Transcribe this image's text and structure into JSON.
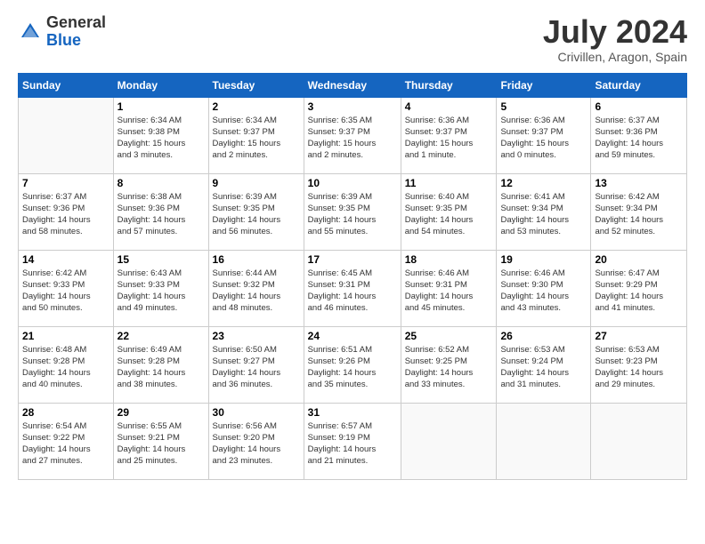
{
  "header": {
    "logo_general": "General",
    "logo_blue": "Blue",
    "month_year": "July 2024",
    "location": "Crivillen, Aragon, Spain"
  },
  "weekdays": [
    "Sunday",
    "Monday",
    "Tuesday",
    "Wednesday",
    "Thursday",
    "Friday",
    "Saturday"
  ],
  "weeks": [
    [
      {
        "day": "",
        "info": ""
      },
      {
        "day": "1",
        "info": "Sunrise: 6:34 AM\nSunset: 9:38 PM\nDaylight: 15 hours\nand 3 minutes."
      },
      {
        "day": "2",
        "info": "Sunrise: 6:34 AM\nSunset: 9:37 PM\nDaylight: 15 hours\nand 2 minutes."
      },
      {
        "day": "3",
        "info": "Sunrise: 6:35 AM\nSunset: 9:37 PM\nDaylight: 15 hours\nand 2 minutes."
      },
      {
        "day": "4",
        "info": "Sunrise: 6:36 AM\nSunset: 9:37 PM\nDaylight: 15 hours\nand 1 minute."
      },
      {
        "day": "5",
        "info": "Sunrise: 6:36 AM\nSunset: 9:37 PM\nDaylight: 15 hours\nand 0 minutes."
      },
      {
        "day": "6",
        "info": "Sunrise: 6:37 AM\nSunset: 9:36 PM\nDaylight: 14 hours\nand 59 minutes."
      }
    ],
    [
      {
        "day": "7",
        "info": "Sunrise: 6:37 AM\nSunset: 9:36 PM\nDaylight: 14 hours\nand 58 minutes."
      },
      {
        "day": "8",
        "info": "Sunrise: 6:38 AM\nSunset: 9:36 PM\nDaylight: 14 hours\nand 57 minutes."
      },
      {
        "day": "9",
        "info": "Sunrise: 6:39 AM\nSunset: 9:35 PM\nDaylight: 14 hours\nand 56 minutes."
      },
      {
        "day": "10",
        "info": "Sunrise: 6:39 AM\nSunset: 9:35 PM\nDaylight: 14 hours\nand 55 minutes."
      },
      {
        "day": "11",
        "info": "Sunrise: 6:40 AM\nSunset: 9:35 PM\nDaylight: 14 hours\nand 54 minutes."
      },
      {
        "day": "12",
        "info": "Sunrise: 6:41 AM\nSunset: 9:34 PM\nDaylight: 14 hours\nand 53 minutes."
      },
      {
        "day": "13",
        "info": "Sunrise: 6:42 AM\nSunset: 9:34 PM\nDaylight: 14 hours\nand 52 minutes."
      }
    ],
    [
      {
        "day": "14",
        "info": "Sunrise: 6:42 AM\nSunset: 9:33 PM\nDaylight: 14 hours\nand 50 minutes."
      },
      {
        "day": "15",
        "info": "Sunrise: 6:43 AM\nSunset: 9:33 PM\nDaylight: 14 hours\nand 49 minutes."
      },
      {
        "day": "16",
        "info": "Sunrise: 6:44 AM\nSunset: 9:32 PM\nDaylight: 14 hours\nand 48 minutes."
      },
      {
        "day": "17",
        "info": "Sunrise: 6:45 AM\nSunset: 9:31 PM\nDaylight: 14 hours\nand 46 minutes."
      },
      {
        "day": "18",
        "info": "Sunrise: 6:46 AM\nSunset: 9:31 PM\nDaylight: 14 hours\nand 45 minutes."
      },
      {
        "day": "19",
        "info": "Sunrise: 6:46 AM\nSunset: 9:30 PM\nDaylight: 14 hours\nand 43 minutes."
      },
      {
        "day": "20",
        "info": "Sunrise: 6:47 AM\nSunset: 9:29 PM\nDaylight: 14 hours\nand 41 minutes."
      }
    ],
    [
      {
        "day": "21",
        "info": "Sunrise: 6:48 AM\nSunset: 9:28 PM\nDaylight: 14 hours\nand 40 minutes."
      },
      {
        "day": "22",
        "info": "Sunrise: 6:49 AM\nSunset: 9:28 PM\nDaylight: 14 hours\nand 38 minutes."
      },
      {
        "day": "23",
        "info": "Sunrise: 6:50 AM\nSunset: 9:27 PM\nDaylight: 14 hours\nand 36 minutes."
      },
      {
        "day": "24",
        "info": "Sunrise: 6:51 AM\nSunset: 9:26 PM\nDaylight: 14 hours\nand 35 minutes."
      },
      {
        "day": "25",
        "info": "Sunrise: 6:52 AM\nSunset: 9:25 PM\nDaylight: 14 hours\nand 33 minutes."
      },
      {
        "day": "26",
        "info": "Sunrise: 6:53 AM\nSunset: 9:24 PM\nDaylight: 14 hours\nand 31 minutes."
      },
      {
        "day": "27",
        "info": "Sunrise: 6:53 AM\nSunset: 9:23 PM\nDaylight: 14 hours\nand 29 minutes."
      }
    ],
    [
      {
        "day": "28",
        "info": "Sunrise: 6:54 AM\nSunset: 9:22 PM\nDaylight: 14 hours\nand 27 minutes."
      },
      {
        "day": "29",
        "info": "Sunrise: 6:55 AM\nSunset: 9:21 PM\nDaylight: 14 hours\nand 25 minutes."
      },
      {
        "day": "30",
        "info": "Sunrise: 6:56 AM\nSunset: 9:20 PM\nDaylight: 14 hours\nand 23 minutes."
      },
      {
        "day": "31",
        "info": "Sunrise: 6:57 AM\nSunset: 9:19 PM\nDaylight: 14 hours\nand 21 minutes."
      },
      {
        "day": "",
        "info": ""
      },
      {
        "day": "",
        "info": ""
      },
      {
        "day": "",
        "info": ""
      }
    ]
  ]
}
